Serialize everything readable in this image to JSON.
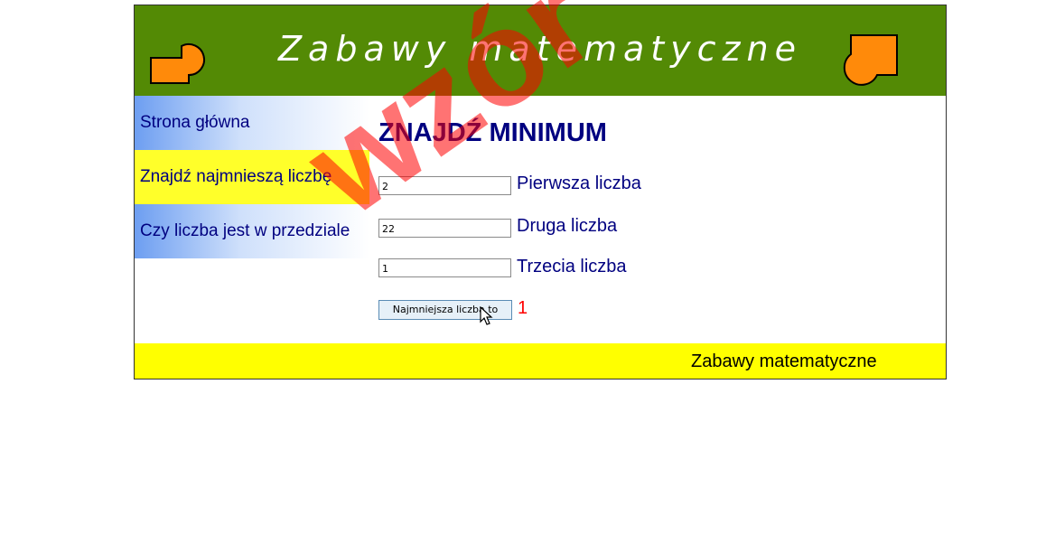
{
  "header": {
    "title": "Zabawy matematyczne"
  },
  "sidebar": {
    "items": [
      {
        "label": "Strona główna"
      },
      {
        "label": "Znajdź najmnieszą liczbę"
      },
      {
        "label": "Czy liczba jest w przedziale"
      }
    ]
  },
  "main": {
    "heading": "ZNAJDŹ MINIMUM",
    "fields": [
      {
        "value": "2",
        "label": "Pierwsza liczba"
      },
      {
        "value": "22",
        "label": "Druga liczba"
      },
      {
        "value": "1",
        "label": "Trzecia liczba"
      }
    ],
    "button_label": "Najmniejsza liczba to",
    "result": "1"
  },
  "footer": {
    "text": "Zabawy matematyczne"
  },
  "watermark": "wzór",
  "colors": {
    "banner": "#538a05",
    "nav_text": "#000080",
    "active_nav": "#ffff2a",
    "footer": "#ffff00",
    "result": "#ff0000",
    "logo_fill": "#ff8a0a"
  }
}
